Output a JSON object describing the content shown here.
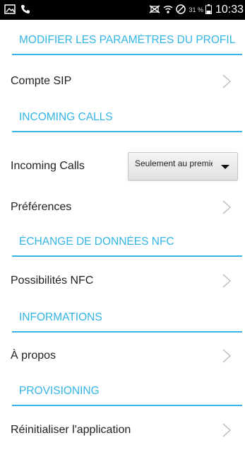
{
  "status_bar": {
    "left_icons": [
      "image-icon",
      "phone-icon"
    ],
    "right_icons": [
      "no-sim-icon",
      "wifi-icon",
      "blocked-icon"
    ],
    "battery_percent": "31 %",
    "time": "10:33"
  },
  "sections": {
    "profile": {
      "title": "MODIFIER LES PARAMÈTRES DU PROFIL"
    },
    "incoming": {
      "title": "INCOMING CALLS"
    },
    "nfc": {
      "title": "ÉCHANGE DE DONNÉES NFC"
    },
    "info": {
      "title": "INFORMATIONS"
    },
    "provisioning": {
      "title": "PROVISIONING"
    }
  },
  "rows": {
    "sip_account": {
      "label": "Compte SIP"
    },
    "incoming_calls": {
      "label": "Incoming Calls",
      "value": "Seulement au premier plan"
    },
    "preferences": {
      "label": "Préférences"
    },
    "nfc": {
      "label": "Possibilités NFC"
    },
    "about": {
      "label": "À propos"
    },
    "reset": {
      "label": "Réinitialiser l'application"
    }
  },
  "colors": {
    "accent": "#33b5e5",
    "status_bar": "#000000",
    "background": "#ffffff"
  }
}
